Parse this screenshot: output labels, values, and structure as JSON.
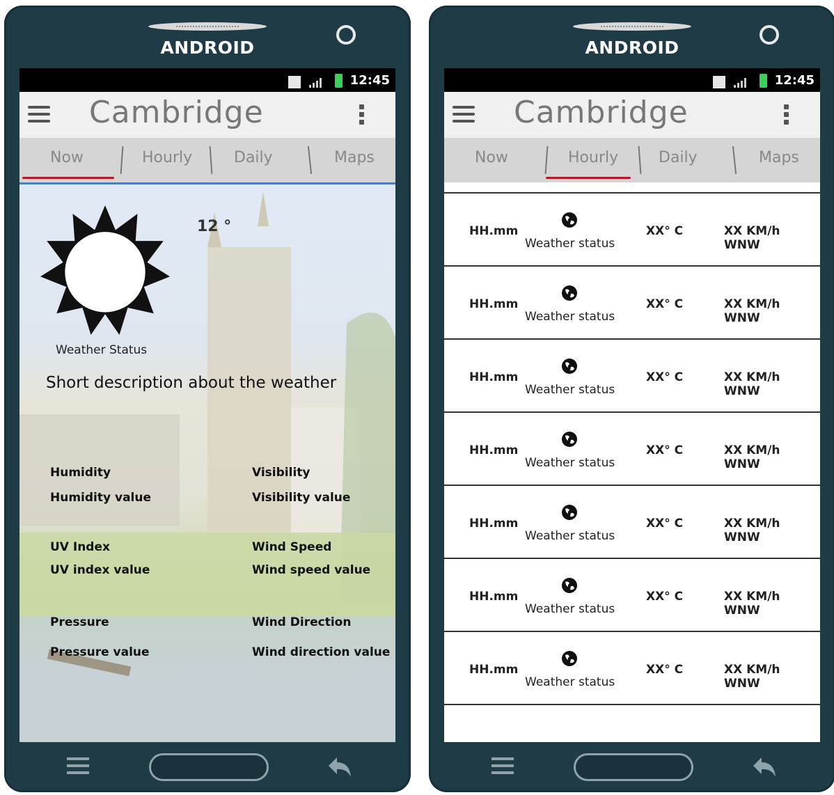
{
  "phones": [
    {
      "brand": "ANDROID",
      "status_time": "12:45",
      "app_title": "Cambridge",
      "tabs": [
        "Now",
        "Hourly",
        "Daily",
        "Maps"
      ],
      "selected_tab": "Now",
      "now": {
        "temperature": "12 °",
        "weather_status": "Weather Status",
        "short_description": "Short description about the weather",
        "details": [
          {
            "label": "Humidity",
            "value": "Humidity value"
          },
          {
            "label": "Visibility",
            "value": "Visibility value"
          },
          {
            "label": "UV Index",
            "value": "UV index value"
          },
          {
            "label": "Wind Speed",
            "value": "Wind speed value"
          },
          {
            "label": "Pressure",
            "value": "Pressure value"
          },
          {
            "label": "Wind Direction",
            "value": "Wind direction value"
          }
        ]
      }
    },
    {
      "brand": "ANDROID",
      "status_time": "12:45",
      "app_title": "Cambridge",
      "tabs": [
        "Now",
        "Hourly",
        "Daily",
        "Maps"
      ],
      "selected_tab": "Hourly",
      "hourly_rows": [
        {
          "time": "HH.mm",
          "status": "Weather status",
          "temp": "XX° C",
          "wind": "XX KM/h WNW"
        },
        {
          "time": "HH.mm",
          "status": "Weather status",
          "temp": "XX° C",
          "wind": "XX KM/h WNW"
        },
        {
          "time": "HH.mm",
          "status": "Weather status",
          "temp": "XX° C",
          "wind": "XX KM/h WNW"
        },
        {
          "time": "HH.mm",
          "status": "Weather status",
          "temp": "XX° C",
          "wind": "XX KM/h WNW"
        },
        {
          "time": "HH.mm",
          "status": "Weather status",
          "temp": "XX° C",
          "wind": "XX KM/h WNW"
        },
        {
          "time": "HH.mm",
          "status": "Weather status",
          "temp": "XX° C",
          "wind": "XX KM/h WNW"
        },
        {
          "time": "HH.mm",
          "status": "Weather status",
          "temp": "XX° C",
          "wind": "XX KM/h WNW"
        }
      ]
    }
  ],
  "icons": {
    "sun": "sun-icon",
    "globe": "globe-icon",
    "menu": "hamburger-menu-icon",
    "overflow": "more-vert-icon",
    "back": "back-arrow-icon"
  },
  "colors": {
    "phone_body": "#1f3c46",
    "tab_underline": "#b51a1a",
    "content_top_border": "#4a7fc4"
  }
}
